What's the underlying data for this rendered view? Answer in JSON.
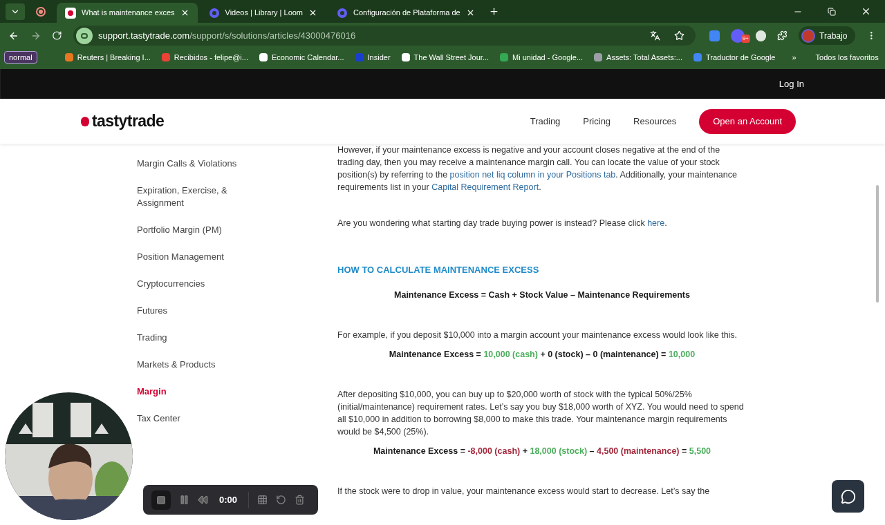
{
  "browser": {
    "tabs": [
      {
        "title": "What is maintenance exces",
        "selected": true,
        "kind": "tt"
      },
      {
        "title": "Videos | Library | Loom",
        "selected": false,
        "kind": "loom"
      },
      {
        "title": "Configuración de Plataforma de",
        "selected": false,
        "kind": "loom"
      }
    ],
    "address": {
      "domain": "support.tastytrade.com",
      "path": "/support/s/solutions/articles/43000476016"
    },
    "extension_badge": "9+",
    "profile": "Trabajo",
    "bookmarks": {
      "profile_chip": "normal",
      "items": [
        {
          "label": "Reuters | Breaking I...",
          "color": "#e87722"
        },
        {
          "label": "Recibidos - felipe@i...",
          "color": "#ea4335"
        },
        {
          "label": "Economic Calendar...",
          "color": "#ffffff"
        },
        {
          "label": "Insider",
          "color": "#1a3fd0"
        },
        {
          "label": "The Wall Street Jour...",
          "color": "#ffffff"
        },
        {
          "label": "Mi unidad - Google...",
          "color": "#34a853"
        },
        {
          "label": "Assets: Total Assets:...",
          "color": "#9aa0a6"
        },
        {
          "label": "Traductor de Google",
          "color": "#4285f4"
        }
      ],
      "overflow": "»",
      "all": "Todos los favoritos"
    }
  },
  "site": {
    "login": "Log In",
    "logo": "tastytrade",
    "nav": [
      "Trading",
      "Pricing",
      "Resources"
    ],
    "cta": "Open an Account"
  },
  "sidebar": {
    "items": [
      {
        "label": "Margin Calls & Violations",
        "selected": false
      },
      {
        "label": "Expiration, Exercise, & Assignment",
        "selected": false
      },
      {
        "label": "Portfolio Margin (PM)",
        "selected": false
      },
      {
        "label": "Position Management",
        "selected": false
      },
      {
        "label": "Cryptocurrencies",
        "selected": false
      },
      {
        "label": "Futures",
        "selected": false
      },
      {
        "label": "Trading",
        "selected": false
      },
      {
        "label": "Markets & Products",
        "selected": false
      },
      {
        "label": "Margin",
        "selected": true
      },
      {
        "label": "Tax Center",
        "selected": false
      }
    ]
  },
  "article": [
    {
      "kind": "paragraph",
      "segments": [
        {
          "text": "However, if your maintenance excess is negative and your account closes negative at the end of the trading day, then you may receive a maintenance margin call. You can locate the value of your stock position(s) by referring to the ",
          "link": false
        },
        {
          "text": "position net liq column in your Positions tab",
          "link": true
        },
        {
          "text": ". Additionally, your maintenance requirements list in your ",
          "link": false
        },
        {
          "text": "Capital Requirement Report",
          "link": true
        },
        {
          "text": ".",
          "link": false
        }
      ]
    },
    {
      "kind": "paragraph",
      "segments": [
        {
          "text": "Are you wondering what starting day trade buying power is instead? Please click ",
          "link": false
        },
        {
          "text": "here",
          "link": true
        },
        {
          "text": ".",
          "link": false
        }
      ]
    },
    {
      "kind": "heading",
      "text": "HOW TO CALCULATE MAINTENANCE EXCESS"
    },
    {
      "kind": "formula",
      "segments": [
        {
          "text": "Maintenance Excess = Cash + Stock Value – Maintenance Requirements",
          "color": "#1a1a1a"
        }
      ]
    },
    {
      "kind": "paragraph",
      "segments": [
        {
          "text": "For example, if you deposit $10,000 into a margin account your maintenance excess would look like this.",
          "link": false
        }
      ]
    },
    {
      "kind": "formula",
      "segments": [
        {
          "text": "Maintenance Excess = ",
          "color": "#1a1a1a"
        },
        {
          "text": "10,000 (cash)",
          "color": "#4cae5c"
        },
        {
          "text": " + 0 (stock) – 0 (maintenance) = ",
          "color": "#1a1a1a"
        },
        {
          "text": "10,000",
          "color": "#4cae5c"
        }
      ]
    },
    {
      "kind": "paragraph",
      "segments": [
        {
          "text": "After depositing $10,000, you can buy up to $20,000 worth of stock with the typical 50%/25% (initial/maintenance) requirement rates. Let’s say you buy $18,000 worth of XYZ. You would need to spend all $10,000 in addition to borrowing $8,000 to make this trade. Your maintenance margin requirements would be $4,500 (25%).",
          "link": false
        }
      ]
    },
    {
      "kind": "formula",
      "segments": [
        {
          "text": "Maintenance Excess = ",
          "color": "#1a1a1a"
        },
        {
          "text": "-8,000 (cash)",
          "color": "#a3273a"
        },
        {
          "text": " + ",
          "color": "#1a1a1a"
        },
        {
          "text": "18,000 (stock)",
          "color": "#4cae5c"
        },
        {
          "text": " – ",
          "color": "#1a1a1a"
        },
        {
          "text": "4,500 (maintenance)",
          "color": "#a3273a"
        },
        {
          "text": " = ",
          "color": "#1a1a1a"
        },
        {
          "text": "5,500",
          "color": "#4cae5c"
        }
      ]
    },
    {
      "kind": "paragraph",
      "segments": [
        {
          "text": "If the stock were to drop in value, your maintenance excess would start to decrease. Let’s say the",
          "link": false
        }
      ]
    }
  ],
  "recorder": {
    "time": "0:00"
  }
}
